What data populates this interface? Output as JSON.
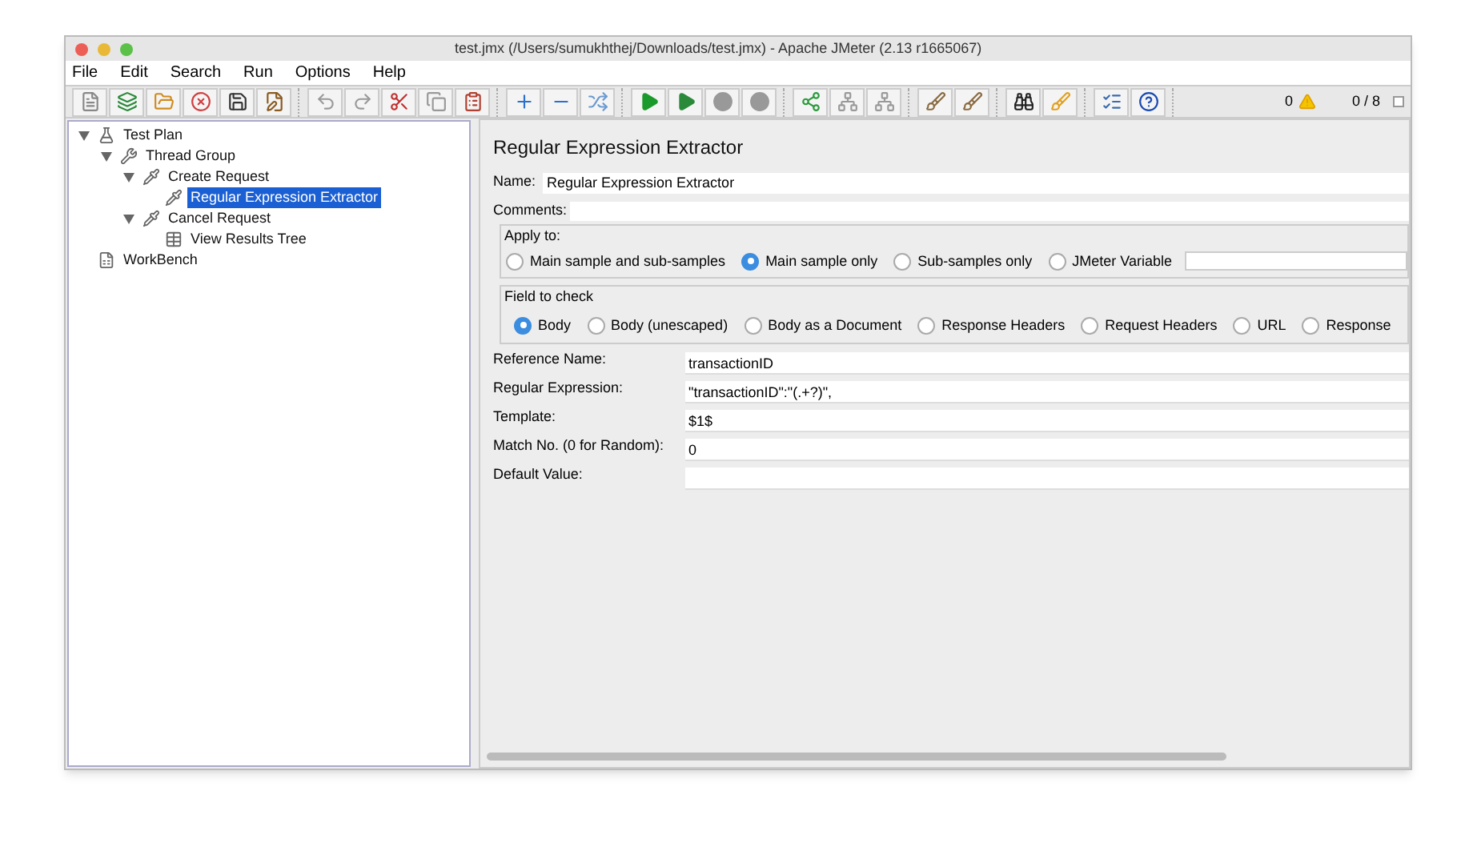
{
  "window": {
    "title": "test.jmx (/Users/sumukhthej/Downloads/test.jmx) - Apache JMeter (2.13 r1665067)"
  },
  "menu": [
    "File",
    "Edit",
    "Search",
    "Run",
    "Options",
    "Help"
  ],
  "toolbar": {
    "warnings": "0",
    "threads": "0 / 8",
    "checked": false
  },
  "tree": [
    {
      "label": "Test Plan",
      "kind": "plan",
      "expanded": true,
      "selected": false,
      "children": [
        {
          "label": "Thread Group",
          "kind": "threads",
          "expanded": true,
          "selected": false,
          "children": [
            {
              "label": "Create Request",
              "kind": "sampler",
              "expanded": true,
              "selected": false,
              "children": [
                {
                  "label": "Regular Expression Extractor",
                  "kind": "extractor",
                  "selected": true
                }
              ]
            },
            {
              "label": "Cancel Request",
              "kind": "sampler",
              "expanded": true,
              "selected": false,
              "children": [
                {
                  "label": "View Results Tree",
                  "kind": "listener",
                  "selected": false
                }
              ]
            }
          ]
        }
      ]
    },
    {
      "label": "WorkBench",
      "kind": "bench",
      "selected": false
    }
  ],
  "panel": {
    "title": "Regular Expression Extractor",
    "name": {
      "label": "Name:",
      "value": "Regular Expression Extractor"
    },
    "comments": {
      "label": "Comments:"
    },
    "apply_to": {
      "title": "Apply to:",
      "options": [
        {
          "label": "Main sample and sub-samples",
          "selected": false
        },
        {
          "label": "Main sample only",
          "selected": true
        },
        {
          "label": "Sub-samples only",
          "selected": false
        },
        {
          "label": "JMeter Variable",
          "selected": false
        }
      ]
    },
    "field_to_check": {
      "title": "Field to check",
      "options": [
        {
          "label": "Body",
          "selected": true
        },
        {
          "label": "Body (unescaped)",
          "selected": false
        },
        {
          "label": "Body as a Document",
          "selected": false
        },
        {
          "label": "Response Headers",
          "selected": false
        },
        {
          "label": "Request Headers",
          "selected": false
        },
        {
          "label": "URL",
          "selected": false
        },
        {
          "label": "Response",
          "selected": false
        }
      ]
    },
    "fields": [
      {
        "label": "Reference Name:",
        "value": "transactionID"
      },
      {
        "label": "Regular Expression:",
        "value": "\"transactionID\":\"(.+?)\","
      },
      {
        "label": "Template:",
        "value": "$1$"
      },
      {
        "label": "Match No. (0 for Random):",
        "value": "0"
      },
      {
        "label": "Default Value:"
      }
    ]
  }
}
